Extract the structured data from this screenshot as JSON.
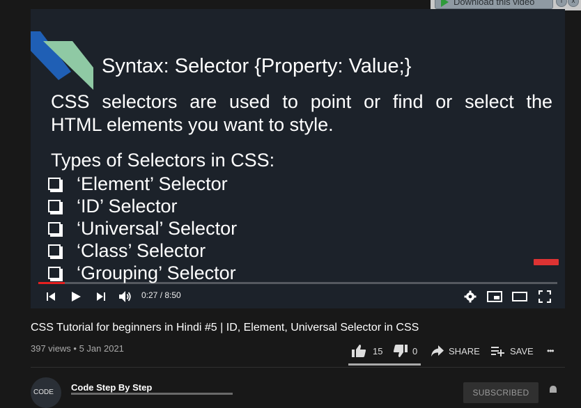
{
  "download_bar": {
    "button_label": "Download this video",
    "info_icon": "i",
    "close_icon": "x"
  },
  "slide": {
    "syntax": "Syntax: Selector {Property: Value;}",
    "description_line1": "CSS selectors are used to point or find or select the",
    "description_line2": "HTML elements you want to style.",
    "types_heading": "Types of Selectors in CSS:",
    "selectors": [
      "‘Element’ Selector",
      "‘ID’ Selector",
      "‘Universal’ Selector",
      "‘Class’ Selector",
      "‘Grouping’ Selector"
    ],
    "logo_colors": {
      "blue": "#1f5fb5",
      "green": "#8fc9a4"
    }
  },
  "player": {
    "time": "0:27 / 8:50",
    "progress": 0.051,
    "icons": {
      "previous": "skip-previous-icon",
      "play": "play-icon",
      "next": "skip-next-icon",
      "volume": "volume-icon",
      "settings": "gear-icon",
      "miniplayer": "miniplayer-icon",
      "theater": "theater-mode-icon",
      "fullscreen": "fullscreen-icon"
    },
    "accent_color": "#e52020"
  },
  "video": {
    "title": "CSS Tutorial for beginners in Hindi #5 | ID, Element, Universal Selector in CSS",
    "meta": "397 views • 5 Jan 2021",
    "likes": "15",
    "dislikes": "0",
    "like_ratio": 1.0,
    "share_label": "SHARE",
    "save_label": "SAVE",
    "more_label": "•••"
  },
  "channel": {
    "name": "Code Step By Step",
    "avatar_text": "CODE",
    "subscribe_label": "SUBSCRIBED"
  }
}
